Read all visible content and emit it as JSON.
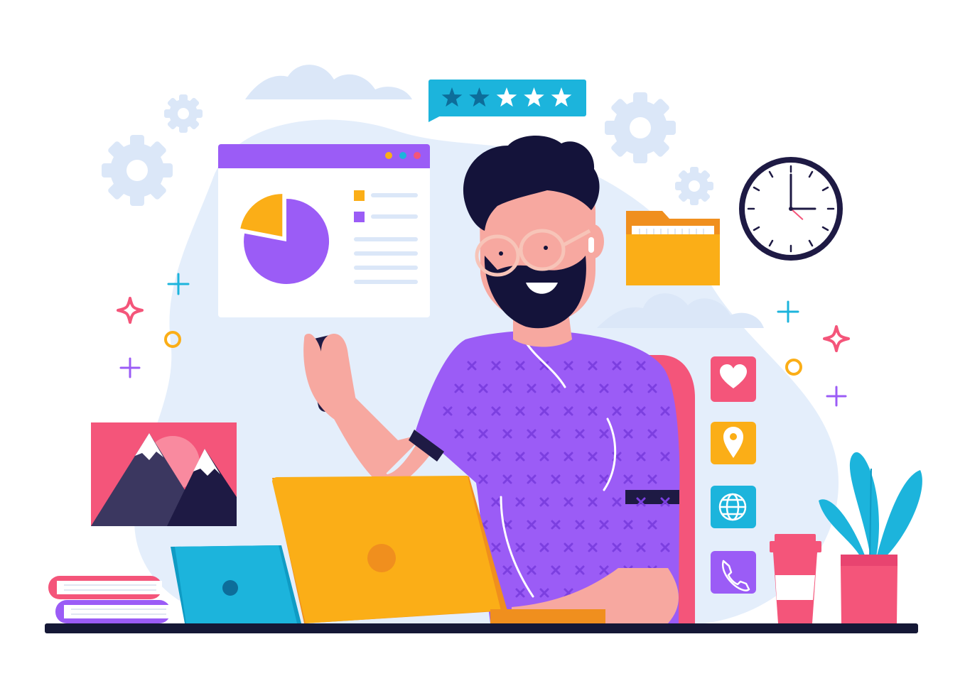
{
  "colors": {
    "background": "#ffffff",
    "backdrop_blob": "#e4eefb",
    "gear": "#dbe7f8",
    "purple": "#9b5cf6",
    "purple_dark": "#7c3fe0",
    "orange": "#fbae17",
    "orange_dark": "#f08f1e",
    "pink": "#f4557a",
    "blue": "#1cb4dc",
    "navy": "#1e1a44",
    "skin": "#f7a8a0",
    "beard": "#14133a",
    "desk": "#151836"
  },
  "rating": {
    "filled_stars": 2,
    "total_stars": 5
  },
  "pie_chart_widget": {
    "slices": [
      0.22,
      0.78
    ],
    "slice_colors": [
      "#fbae17",
      "#9b5cf6"
    ]
  },
  "clock": {
    "hour": 3,
    "minute": 0,
    "second": 22
  },
  "app_icons": [
    "heart-icon",
    "location-pin-icon",
    "globe-icon",
    "phone-icon"
  ]
}
